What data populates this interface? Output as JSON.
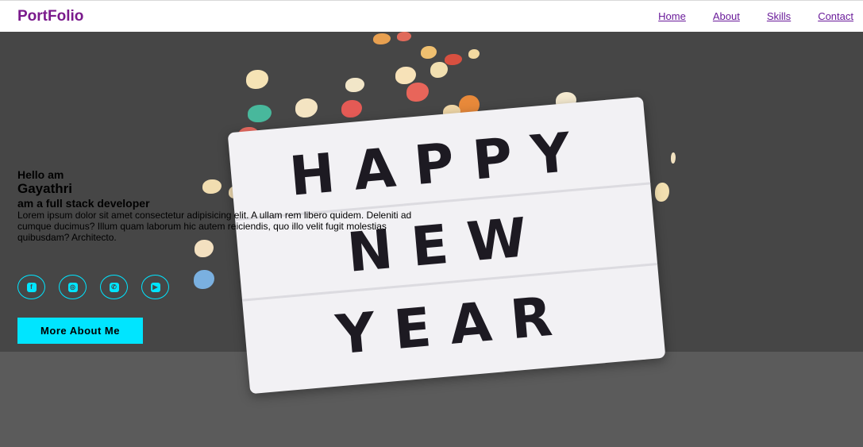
{
  "navbar": {
    "logo": "PortFolio",
    "links": [
      "Home",
      "About",
      "Skills",
      "Contact"
    ]
  },
  "hero": {
    "greeting": "Hello am",
    "name": "Gayathri",
    "role": "am a full stack developer",
    "description": "Lorem ipsum dolor sit amet consectetur adipisicing elit. A ullam rem libero quidem. Deleniti ad cumque ducimus? Illum quam laborum hic autem reiciendis, quo illo velit fugit molestias quibusdam? Architecto.",
    "cta_label": "More About Me",
    "lightbox_lines": [
      "HAPPY",
      "NEW",
      "YEAR"
    ],
    "socials": [
      {
        "icon": "facebook-icon",
        "glyph": "f"
      },
      {
        "icon": "instagram-icon",
        "glyph": "◎"
      },
      {
        "icon": "whatsapp-icon",
        "glyph": "✆"
      },
      {
        "icon": "youtube-icon",
        "glyph": "▶"
      }
    ]
  },
  "colors": {
    "accent": "#00e5ff",
    "brand": "#7a1a8c",
    "background": "#464646"
  }
}
